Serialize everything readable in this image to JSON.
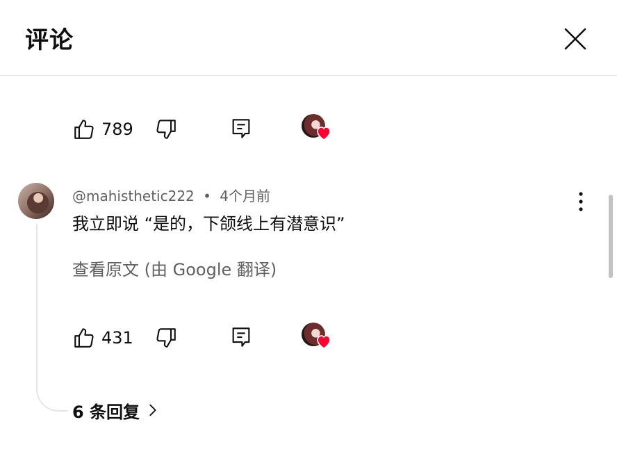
{
  "header": {
    "title": "评论"
  },
  "top_comment_actions": {
    "like_count": "789"
  },
  "comment": {
    "author": "@mahisthetic222",
    "separator": "•",
    "time": "4个月前",
    "text": "我立即说 “是的，下颌线上有潜意识”",
    "translate_label": "查看原文 (由 Google 翻译)",
    "like_count": "431",
    "replies_label": "6 条回复"
  },
  "colors": {
    "heart": "#ff0033",
    "secondary_text": "#606060",
    "divider": "#e5e5e5"
  }
}
